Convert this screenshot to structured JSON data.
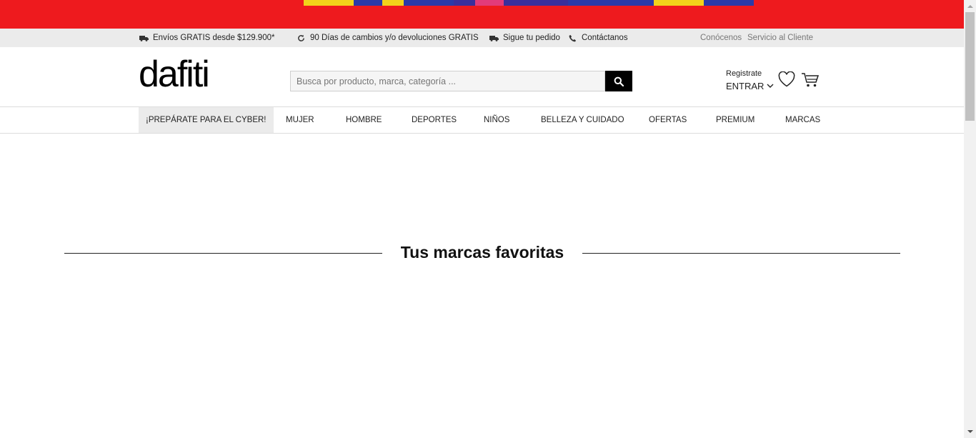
{
  "promo": {
    "colors": [
      "#ee1a1e",
      "#2b3aa8",
      "#f2d21b"
    ]
  },
  "topbar": {
    "items": [
      {
        "icon": "truck-icon",
        "label": "Envíos GRATIS desde $129.900*"
      },
      {
        "icon": "refresh-icon",
        "label": "90 Días de cambios y/o devoluciones GRATIS"
      },
      {
        "icon": "truck-icon",
        "label": "Sigue tu pedido"
      },
      {
        "icon": "phone-icon",
        "label": "Contáctanos"
      }
    ],
    "links": [
      "Conócenos",
      "Servicio al Cliente"
    ]
  },
  "header": {
    "logo": "dafiti",
    "search": {
      "placeholder": "Busca por producto, marca, categoría ...",
      "value": ""
    },
    "account": {
      "register": "Registrate",
      "login": "ENTRAR"
    }
  },
  "nav": {
    "items": [
      "¡PREPÁRATE PARA EL CYBER!",
      "MUJER",
      "HOMBRE",
      "DEPORTES",
      "NIÑOS",
      "BELLEZA Y CUIDADO",
      "OFERTAS",
      "PREMIUM",
      "MARCAS"
    ]
  },
  "main": {
    "section_title": "Tus marcas favoritas"
  },
  "colors": {
    "brand_red": "#ee1a1e",
    "topbar_bg": "#ebebeb",
    "black": "#000000"
  }
}
